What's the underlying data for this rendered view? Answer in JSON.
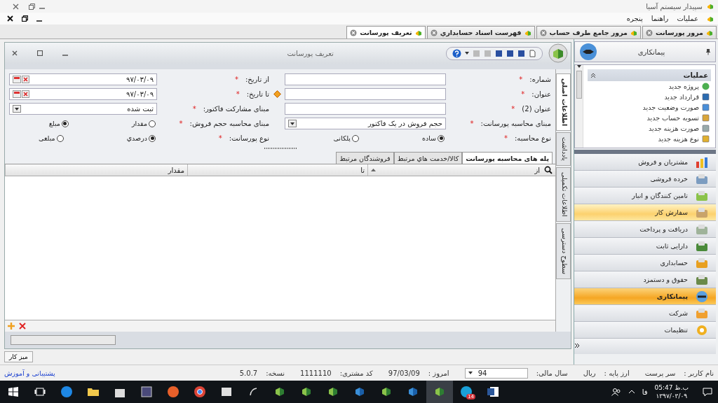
{
  "app": {
    "title": "سپیدار سیستم آسیا"
  },
  "menu": [
    "عملیات",
    "راهنما",
    "پنجره"
  ],
  "doc_tabs": [
    {
      "label": "مرور پورسانت",
      "selected": false
    },
    {
      "label": "مرور جامع طرف حساب",
      "selected": false
    },
    {
      "label": "فهرست اسناد حسابداري",
      "selected": false
    },
    {
      "label": "تعریف پورسانت",
      "selected": true
    }
  ],
  "form": {
    "title": "تعریف پورسانت",
    "side_tabs": [
      {
        "label": "اطلاعات اصلی",
        "selected": true
      },
      {
        "label": "یادداشت",
        "selected": false
      },
      {
        "label": "اطلاعات تکمیلی",
        "selected": false
      },
      {
        "label": "سطوح دسترسی",
        "selected": false
      }
    ],
    "field_pairs": [
      [
        {
          "kind": "text",
          "label": "شماره:",
          "required": "*"
        },
        {
          "kind": "date",
          "label": "از تاریخ:",
          "required": "*",
          "value": "۹۷/۰۳/۰۹"
        }
      ],
      [
        {
          "kind": "text",
          "label": "عنوان:",
          "required": "*",
          "warning": true
        },
        {
          "kind": "date",
          "label": "تا تاریخ:",
          "required": "*",
          "value": "۹۷/۰۳/۰۹"
        }
      ],
      [
        {
          "kind": "text",
          "label": "عنوان (2)",
          "required": "*"
        },
        {
          "kind": "select",
          "label": "مبنای مشارکت فاکتور:",
          "required": "*",
          "value": "ثبت شده"
        }
      ],
      [
        {
          "kind": "select",
          "label": "مبنای محاسبه پورسانت:",
          "required": "*",
          "value": "حجم فروش در یک فاکتور"
        },
        {
          "kind": "radio",
          "label": "مبنای محاسبه حجم فروش:",
          "required": "*",
          "options": [
            {
              "label": "مقدار",
              "selected": false
            },
            {
              "label": "مبلغ",
              "selected": true
            }
          ]
        }
      ],
      [
        {
          "kind": "radio",
          "label": "نوع محاسبه:",
          "required": "*",
          "options": [
            {
              "label": "ساده",
              "selected": true
            },
            {
              "label": "پلکانی",
              "selected": false
            }
          ]
        },
        {
          "kind": "radio",
          "label": "نوع پورسانت:",
          "required": "*",
          "options": [
            {
              "label": "درصدي",
              "selected": true
            },
            {
              "label": "مبلغی",
              "selected": false
            }
          ]
        }
      ]
    ],
    "grid_tabs": [
      {
        "label": "پله های محاسبه پورسانت",
        "selected": true
      },
      {
        "label": "کالا/خدمت هاي مرتبط",
        "selected": false
      },
      {
        "label": "فروشندگان مرتبط",
        "selected": false
      }
    ],
    "columns": [
      {
        "label": "از",
        "sorted": true
      },
      {
        "label": "تا",
        "sorted": false
      },
      {
        "label": "مقدار",
        "sorted": false
      }
    ]
  },
  "sidebar": {
    "title": "پیمانکاری",
    "ops_title": "عملیات",
    "operations": [
      "پروژه جدید",
      "قرارداد جدید",
      "صورت وضعیت جدید",
      "تسویه حساب جدید",
      "صورت هزینه جدید",
      "نوع هزینه جدید"
    ],
    "modules": [
      {
        "label": "مشتریان و فروش",
        "selected": false,
        "hovered": false
      },
      {
        "label": "خرده فروشی",
        "selected": false,
        "hovered": false
      },
      {
        "label": "تامین کنندگان و انبار",
        "selected": false,
        "hovered": false
      },
      {
        "label": "سفارش کار",
        "selected": false,
        "hovered": true
      },
      {
        "label": "دریافت و پرداخت",
        "selected": false,
        "hovered": false
      },
      {
        "label": "دارایی ثابت",
        "selected": false,
        "hovered": false
      },
      {
        "label": "حسابداری",
        "selected": false,
        "hovered": false
      },
      {
        "label": "حقوق و دستمزد",
        "selected": false,
        "hovered": false
      },
      {
        "label": "پیمانکاری",
        "selected": true,
        "hovered": false
      },
      {
        "label": "شرکت",
        "selected": false,
        "hovered": false
      },
      {
        "label": "تنظیمات",
        "selected": false,
        "hovered": false
      }
    ]
  },
  "desk_button": "میز کار",
  "status": {
    "items": [
      {
        "label": "نام کاربر :",
        "value": "سر پرست"
      },
      {
        "label": "ارز پایه :",
        "value": "ریال"
      },
      {
        "label": "سال مالی:",
        "value": "94",
        "kind": "select"
      },
      {
        "label": "امروز :",
        "value": "97/03/09"
      },
      {
        "label": "کد مشتری:",
        "value": "1111110"
      },
      {
        "label": "نسخه:",
        "value": "5.0.7"
      }
    ],
    "link": "پشتیبانی و آموزش"
  },
  "taskbar": {
    "time": "ب.ظ 05:47",
    "date": "۱۳۹۷/۰۳/۰۹",
    "lang": "فا",
    "badge": "14"
  }
}
